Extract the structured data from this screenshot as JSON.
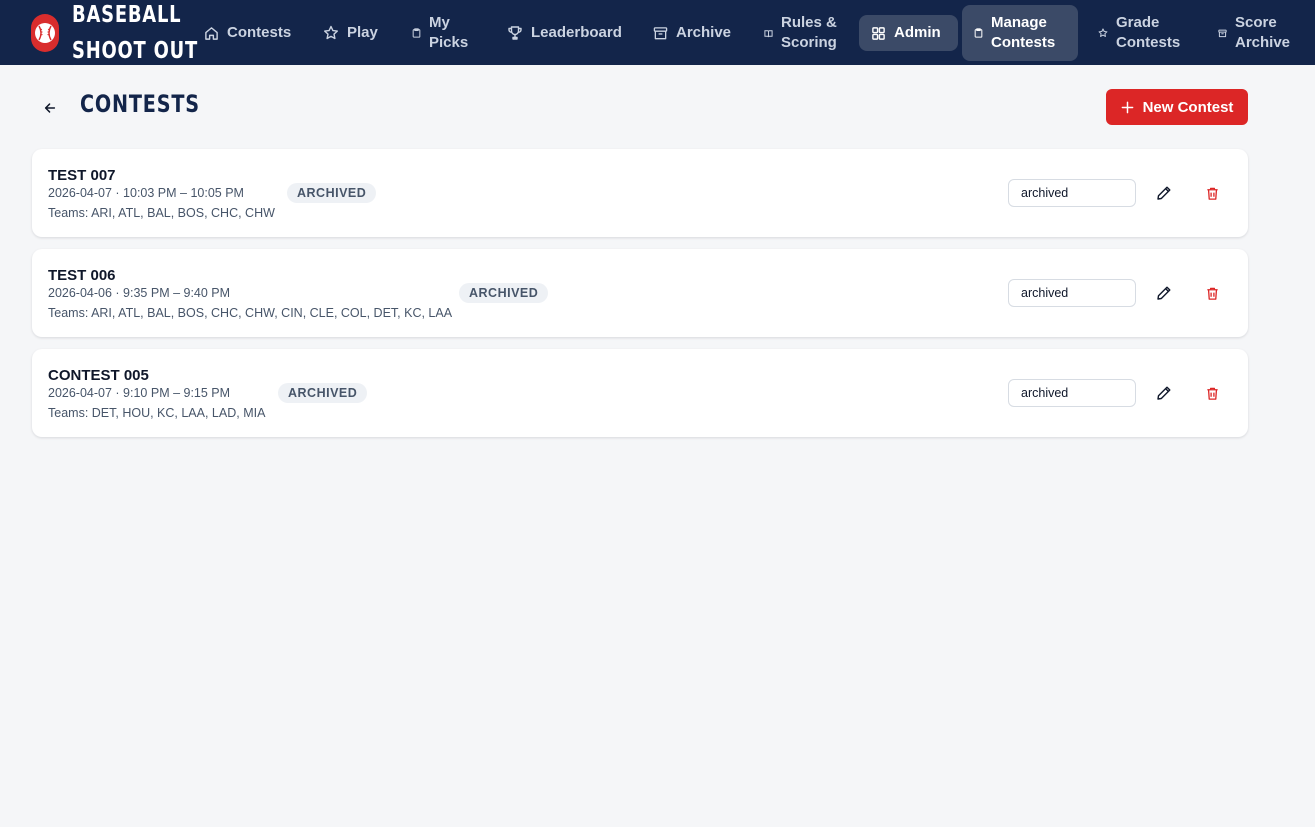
{
  "app": {
    "title_line1": "BASEBALL",
    "title_line2": "SHOOT OUT",
    "logo_icon": "baseball-icon"
  },
  "nav": {
    "items": [
      {
        "id": "contests",
        "label_line1": "Contests",
        "label_line2": "",
        "icon": "home-icon"
      },
      {
        "id": "play",
        "label_line1": "Play",
        "label_line2": "",
        "icon": "star-icon"
      },
      {
        "id": "my-picks",
        "label_line1": "My",
        "label_line2": "Picks",
        "icon": "clipboard-icon"
      },
      {
        "id": "leaderboard",
        "label_line1": "Leaderboard",
        "label_line2": "",
        "icon": "trophy-icon"
      },
      {
        "id": "archive",
        "label_line1": "Archive",
        "label_line2": "",
        "icon": "archive-box-icon"
      },
      {
        "id": "rules",
        "label_line1": "Rules &",
        "label_line2": "Scoring",
        "icon": "book-icon"
      },
      {
        "id": "admin",
        "label_line1": "Admin",
        "label_line2": "",
        "icon": "grid-icon"
      },
      {
        "id": "manage-contests",
        "label_line1": "Manage",
        "label_line2": "Contests",
        "icon": "clipboard-icon"
      },
      {
        "id": "grade-contests",
        "label_line1": "Grade",
        "label_line2": "Contests",
        "icon": "star-icon"
      },
      {
        "id": "score-archive",
        "label_line1": "Score",
        "label_line2": "Archive",
        "icon": "archive-box-icon"
      }
    ]
  },
  "page": {
    "title": "CONTESTS",
    "new_button_label": "New Contest"
  },
  "contests": [
    {
      "name": "TEST 007",
      "datetime": "2026-04-07 · 10:03 PM – 10:05 PM",
      "teams": "Teams: ARI, ATL, BAL, BOS, CHC, CHW",
      "badge": "ARCHIVED",
      "status": "archived"
    },
    {
      "name": "TEST 006",
      "datetime": "2026-04-06 · 9:35 PM – 9:40 PM",
      "teams": "Teams: ARI, ATL, BAL, BOS, CHC, CHW, CIN, CLE, COL, DET, KC, LAA",
      "badge": "ARCHIVED",
      "status": "archived"
    },
    {
      "name": "CONTEST 005",
      "datetime": "2026-04-07 · 9:10 PM – 9:15 PM",
      "teams": "Teams: DET, HOU, KC, LAA, LAD, MIA",
      "badge": "ARCHIVED",
      "status": "archived"
    }
  ],
  "colors": {
    "navbar": "#13254a",
    "accent_red": "#dc2626",
    "active_nav": "#3b4a67",
    "background": "#f5f6f8"
  }
}
